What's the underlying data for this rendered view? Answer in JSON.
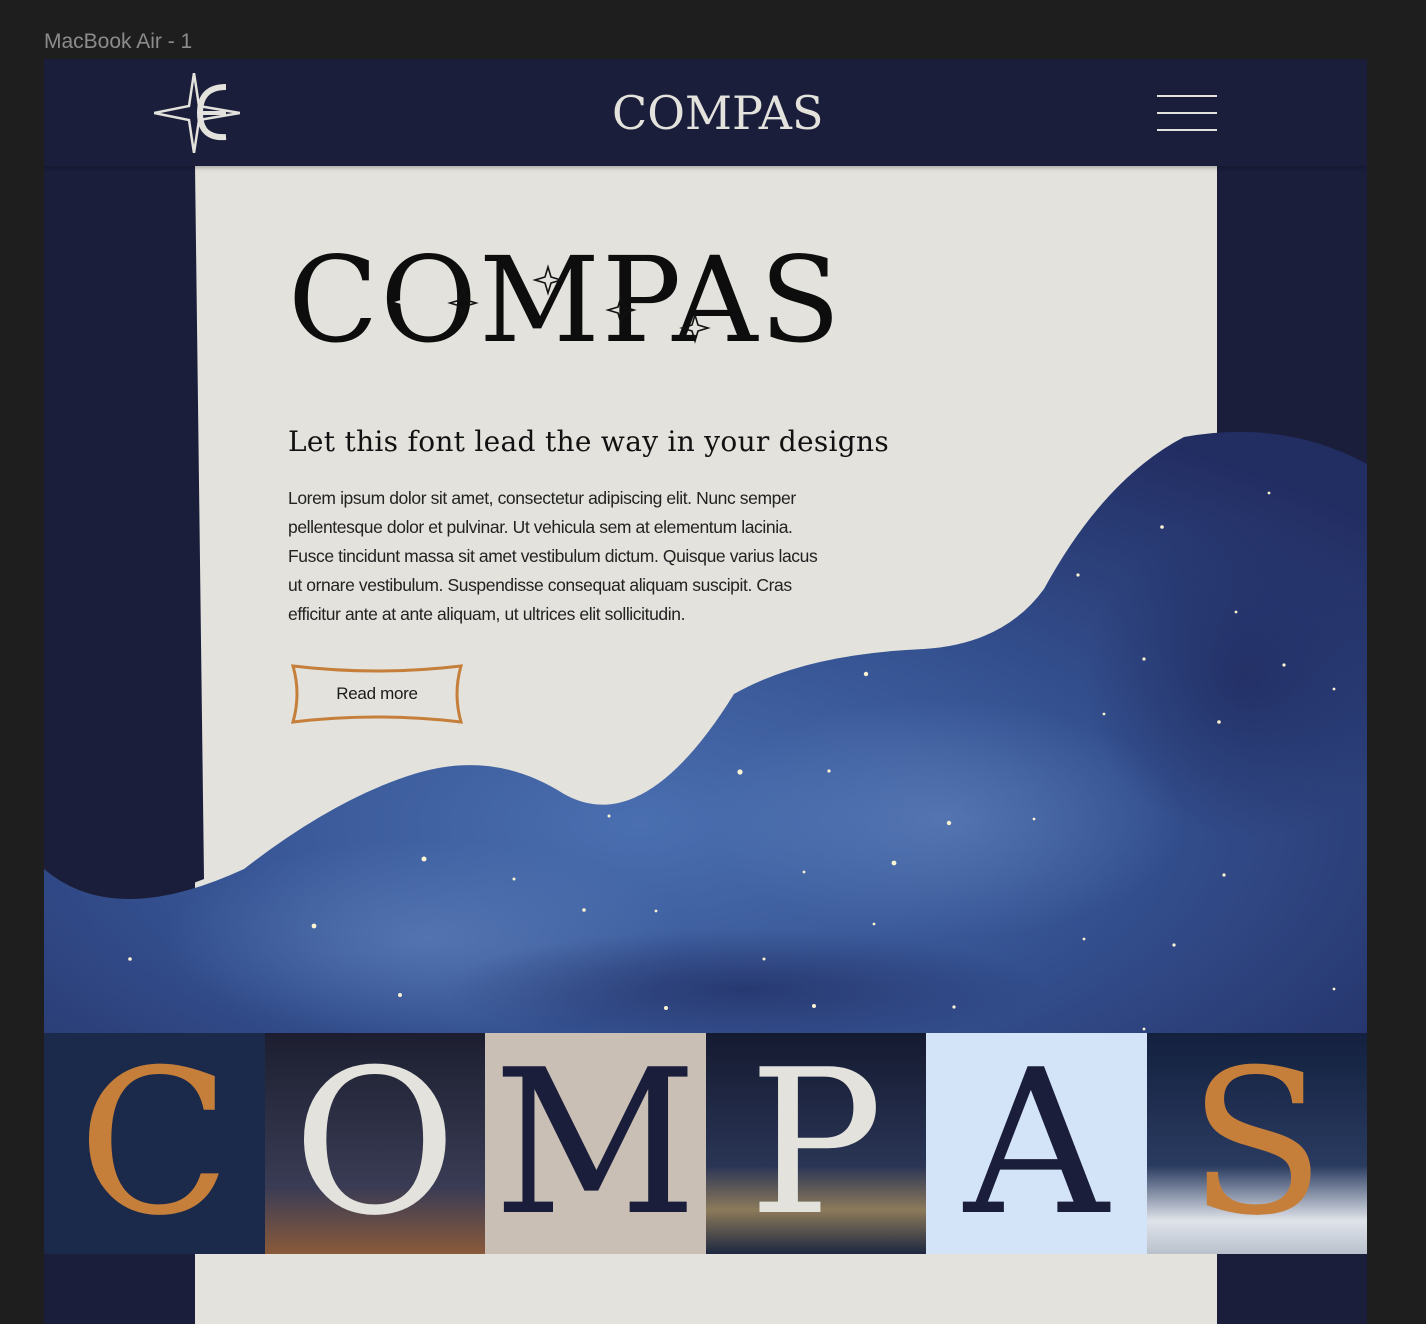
{
  "editor": {
    "frame_label": "MacBook Air - 1"
  },
  "header": {
    "logo_name": "compas-star-logo",
    "wordmark": "COMPAS",
    "menu_icon": "hamburger-menu-icon"
  },
  "hero": {
    "title": "COMPAS",
    "tagline": "Let this font lead the way in your designs",
    "body": "Lorem ipsum dolor sit amet, consectetur adipiscing elit. Nunc semper pellentesque dolor et pulvinar. Ut vehicula sem at elementum lacinia. Fusce tincidunt massa sit amet vestibulum dictum. Quisque varius lacus ut ornare vestibulum. Suspendisse consequat aliquam  suscipit. Cras efficitur ante at ante aliquam, ut ultrices elit  sollicitudin.",
    "cta_label": "Read more"
  },
  "letters": [
    {
      "char": "C",
      "color": "#c57f3a",
      "bg": "#1b2a4a"
    },
    {
      "char": "O",
      "color": "#e3e2dc",
      "bg": "#2a2c3e"
    },
    {
      "char": "M",
      "color": "#1a1e3b",
      "bg": "#c9bfb4"
    },
    {
      "char": "P",
      "color": "#e3e2dc",
      "bg": "#1d2740"
    },
    {
      "char": "A",
      "color": "#1a1e3b",
      "bg": "#d4e4f8"
    },
    {
      "char": "S",
      "color": "#c57f3a",
      "bg": "#1a2646"
    }
  ],
  "colors": {
    "navy": "#1a1e3b",
    "cream": "#e3e2dc",
    "copper": "#c57f3a",
    "sky_blue": "#3a5a98",
    "editor_bg": "#1e1e1e"
  }
}
